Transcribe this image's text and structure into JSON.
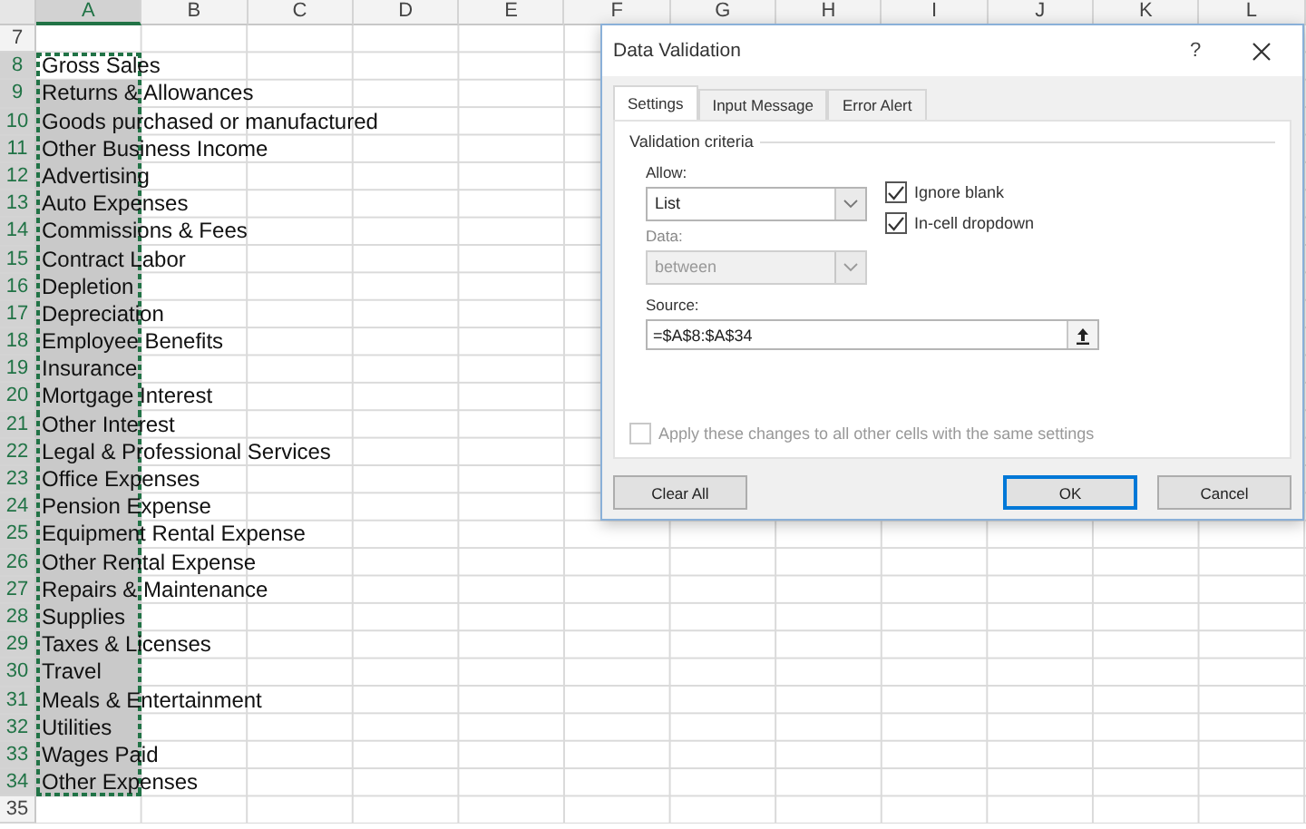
{
  "sheet": {
    "columns": [
      {
        "label": "A",
        "selected": true
      },
      {
        "label": "B",
        "selected": false
      },
      {
        "label": "C",
        "selected": false
      },
      {
        "label": "D",
        "selected": false
      },
      {
        "label": "E",
        "selected": false
      },
      {
        "label": "F",
        "selected": false
      },
      {
        "label": "G",
        "selected": false
      },
      {
        "label": "H",
        "selected": false
      },
      {
        "label": "I",
        "selected": false
      },
      {
        "label": "J",
        "selected": false
      },
      {
        "label": "K",
        "selected": false
      },
      {
        "label": "L",
        "selected": false
      }
    ],
    "rows": [
      {
        "number": "7",
        "selected": false,
        "active": false
      },
      {
        "number": "8",
        "text": "Gross Sales",
        "selected": true,
        "active": true
      },
      {
        "number": "9",
        "text": "Returns & Allowances",
        "selected": true,
        "active": false
      },
      {
        "number": "10",
        "text": "Goods purchased or manufactured",
        "selected": true,
        "active": false
      },
      {
        "number": "11",
        "text": "Other Business Income",
        "selected": true,
        "active": false
      },
      {
        "number": "12",
        "text": "Advertising",
        "selected": true,
        "active": false
      },
      {
        "number": "13",
        "text": "Auto Expenses",
        "selected": true,
        "active": false
      },
      {
        "number": "14",
        "text": "Commissions & Fees",
        "selected": true,
        "active": false
      },
      {
        "number": "15",
        "text": "Contract Labor",
        "selected": true,
        "active": false
      },
      {
        "number": "16",
        "text": "Depletion",
        "selected": true,
        "active": false
      },
      {
        "number": "17",
        "text": "Depreciation",
        "selected": true,
        "active": false
      },
      {
        "number": "18",
        "text": "Employee Benefits",
        "selected": true,
        "active": false
      },
      {
        "number": "19",
        "text": "Insurance",
        "selected": true,
        "active": false
      },
      {
        "number": "20",
        "text": "Mortgage Interest",
        "selected": true,
        "active": false
      },
      {
        "number": "21",
        "text": "Other Interest",
        "selected": true,
        "active": false
      },
      {
        "number": "22",
        "text": "Legal & Professional Services",
        "selected": true,
        "active": false
      },
      {
        "number": "23",
        "text": "Office Expenses",
        "selected": true,
        "active": false
      },
      {
        "number": "24",
        "text": "Pension Expense",
        "selected": true,
        "active": false
      },
      {
        "number": "25",
        "text": "Equipment Rental Expense",
        "selected": true,
        "active": false
      },
      {
        "number": "26",
        "text": "Other Rental Expense",
        "selected": true,
        "active": false
      },
      {
        "number": "27",
        "text": "Repairs & Maintenance",
        "selected": true,
        "active": false
      },
      {
        "number": "28",
        "text": "Supplies",
        "selected": true,
        "active": false
      },
      {
        "number": "29",
        "text": "Taxes & Licenses",
        "selected": true,
        "active": false
      },
      {
        "number": "30",
        "text": "Travel",
        "selected": true,
        "active": false
      },
      {
        "number": "31",
        "text": "Meals & Entertainment",
        "selected": true,
        "active": false
      },
      {
        "number": "32",
        "text": "Utilities",
        "selected": true,
        "active": false
      },
      {
        "number": "33",
        "text": "Wages Paid",
        "selected": true,
        "active": false
      },
      {
        "number": "34",
        "text": "Other Expenses",
        "selected": true,
        "active": false
      },
      {
        "number": "35",
        "selected": false,
        "active": false
      }
    ]
  },
  "dialog": {
    "title": "Data Validation",
    "help": "?",
    "tabs": [
      {
        "label": "Settings",
        "selected": true
      },
      {
        "label": "Input Message",
        "selected": false
      },
      {
        "label": "Error Alert",
        "selected": false
      }
    ],
    "group": "Validation criteria",
    "allow": {
      "label": "Allow:",
      "value": "List",
      "disabled": false
    },
    "data": {
      "label": "Data:",
      "value": "between",
      "disabled": true
    },
    "options": [
      {
        "label": "Ignore blank",
        "checked": true
      },
      {
        "label": "In-cell dropdown",
        "checked": true
      }
    ],
    "source": {
      "label": "Source:",
      "value": "=$A$8:$A$34"
    },
    "apply": {
      "label": "Apply these changes to all other cells with the same settings",
      "checked": false,
      "disabled": true
    },
    "buttons": [
      {
        "label": "Clear All",
        "default": false
      },
      {
        "label": "OK",
        "default": true
      },
      {
        "label": "Cancel",
        "default": false
      }
    ]
  }
}
